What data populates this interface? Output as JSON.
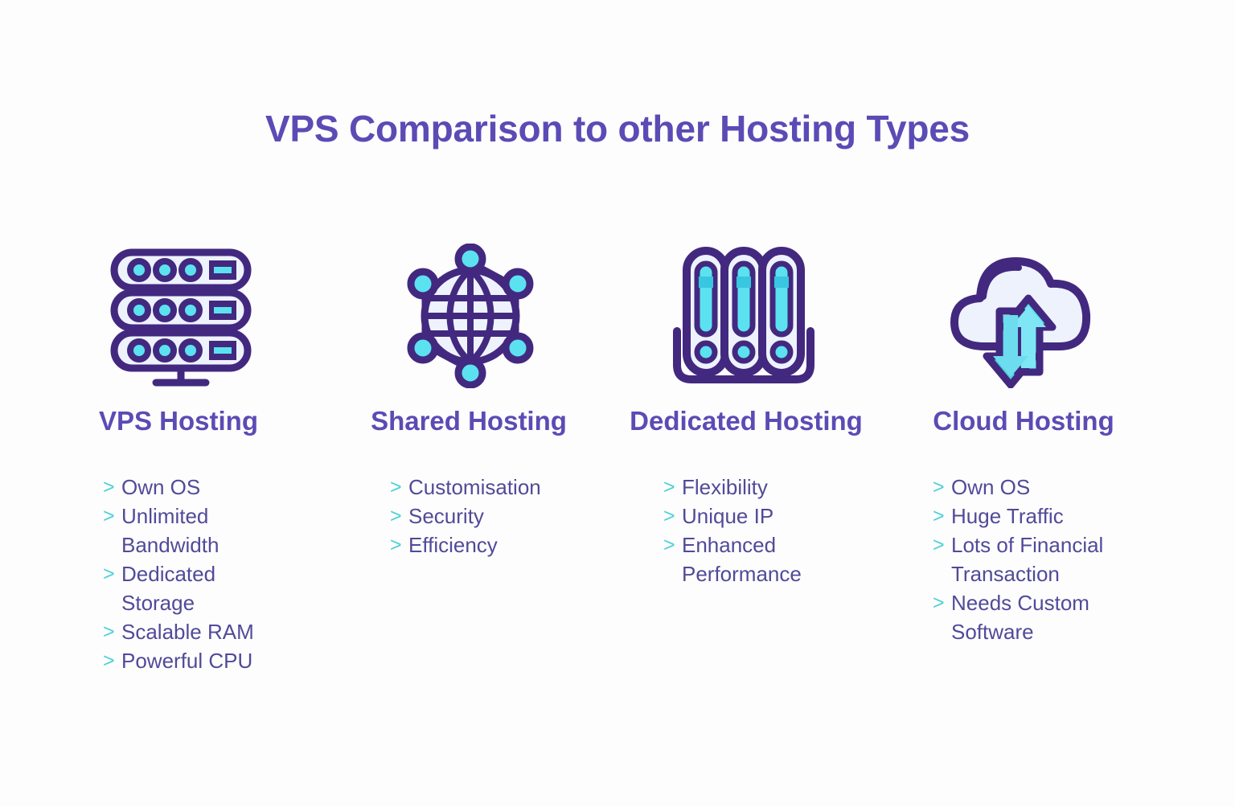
{
  "page": {
    "title": "VPS Comparison to other Hosting Types",
    "background_color": "#fdfdfd"
  },
  "colors": {
    "heading_purple": "#5b4bb5",
    "body_purple": "#514a99",
    "chevron_teal": "#4fd0d8",
    "icon_stroke": "#42297f",
    "icon_cyan": "#5ce1f0",
    "icon_cyan_dark": "#38c6e0",
    "icon_panel": "#eef2fc"
  },
  "columns": [
    {
      "icon": "server-rack-icon",
      "heading_line1": "VPS",
      "heading_line2": "Hosting",
      "heading": "VPS\nHosting",
      "features": [
        "Own OS",
        "Unlimited\nBandwidth",
        "Dedicated\nStorage",
        "Scalable RAM",
        "Powerful CPU"
      ]
    },
    {
      "icon": "network-globe-icon",
      "heading_line1": "Shared",
      "heading_line2": "Hosting",
      "heading": "Shared\nHosting",
      "features": [
        "Customisation",
        "Security",
        "Efficiency"
      ]
    },
    {
      "icon": "server-tower-icon",
      "heading_line1": "Dedicated",
      "heading_line2": "Hosting",
      "heading": "Dedicated\nHosting",
      "features": [
        "Flexibility",
        "Unique IP",
        "Enhanced\nPerformance"
      ]
    },
    {
      "icon": "cloud-transfer-icon",
      "heading_line1": "Cloud",
      "heading_line2": "Hosting",
      "heading": "Cloud\nHosting",
      "features": [
        "Own OS",
        "Huge Traffic",
        "Lots of Financial\nTransaction",
        "Needs Custom\nSoftware"
      ]
    }
  ],
  "bullet_marker": ">"
}
